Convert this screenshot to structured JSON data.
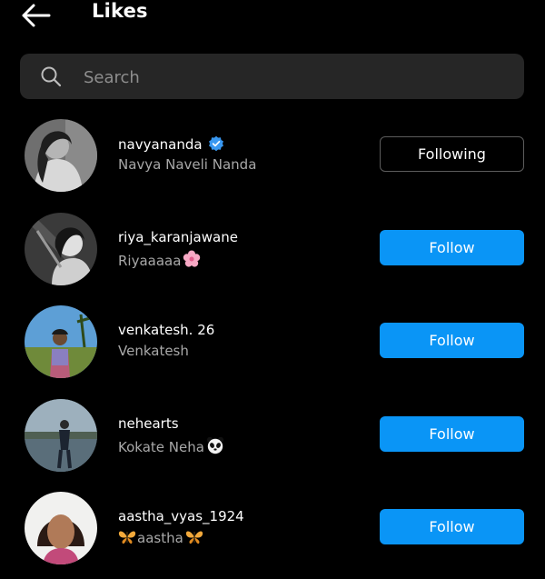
{
  "header": {
    "title": "Likes",
    "back_icon": "arrow-left-icon"
  },
  "search": {
    "placeholder": "Search",
    "value": "",
    "icon": "search-icon"
  },
  "colors": {
    "accent": "#0a95f6",
    "background": "#000000",
    "search_bg": "#262626",
    "secondary_text": "#a8a8a8",
    "verified": "#3897f0"
  },
  "users": [
    {
      "username": "navyananda",
      "full_name": "Navya Naveli Nanda",
      "verified": true,
      "button": "Following",
      "button_state": "following"
    },
    {
      "username": "riya_karanjawane",
      "full_name": "Riyaaaaa",
      "full_name_emoji": "cherry-blossom-icon",
      "verified": false,
      "button": "Follow",
      "button_state": "follow"
    },
    {
      "username": "venkatesh. 26",
      "full_name": "Venkatesh",
      "verified": false,
      "button": "Follow",
      "button_state": "follow"
    },
    {
      "username": "nehearts",
      "full_name": "Kokate Neha",
      "full_name_emoji": "panda-icon",
      "verified": false,
      "button": "Follow",
      "button_state": "follow"
    },
    {
      "username": "aastha_vyas_1924",
      "full_name": "aastha",
      "full_name_emoji": "butterfly-icon",
      "verified": false,
      "button": "Follow",
      "button_state": "follow"
    }
  ]
}
